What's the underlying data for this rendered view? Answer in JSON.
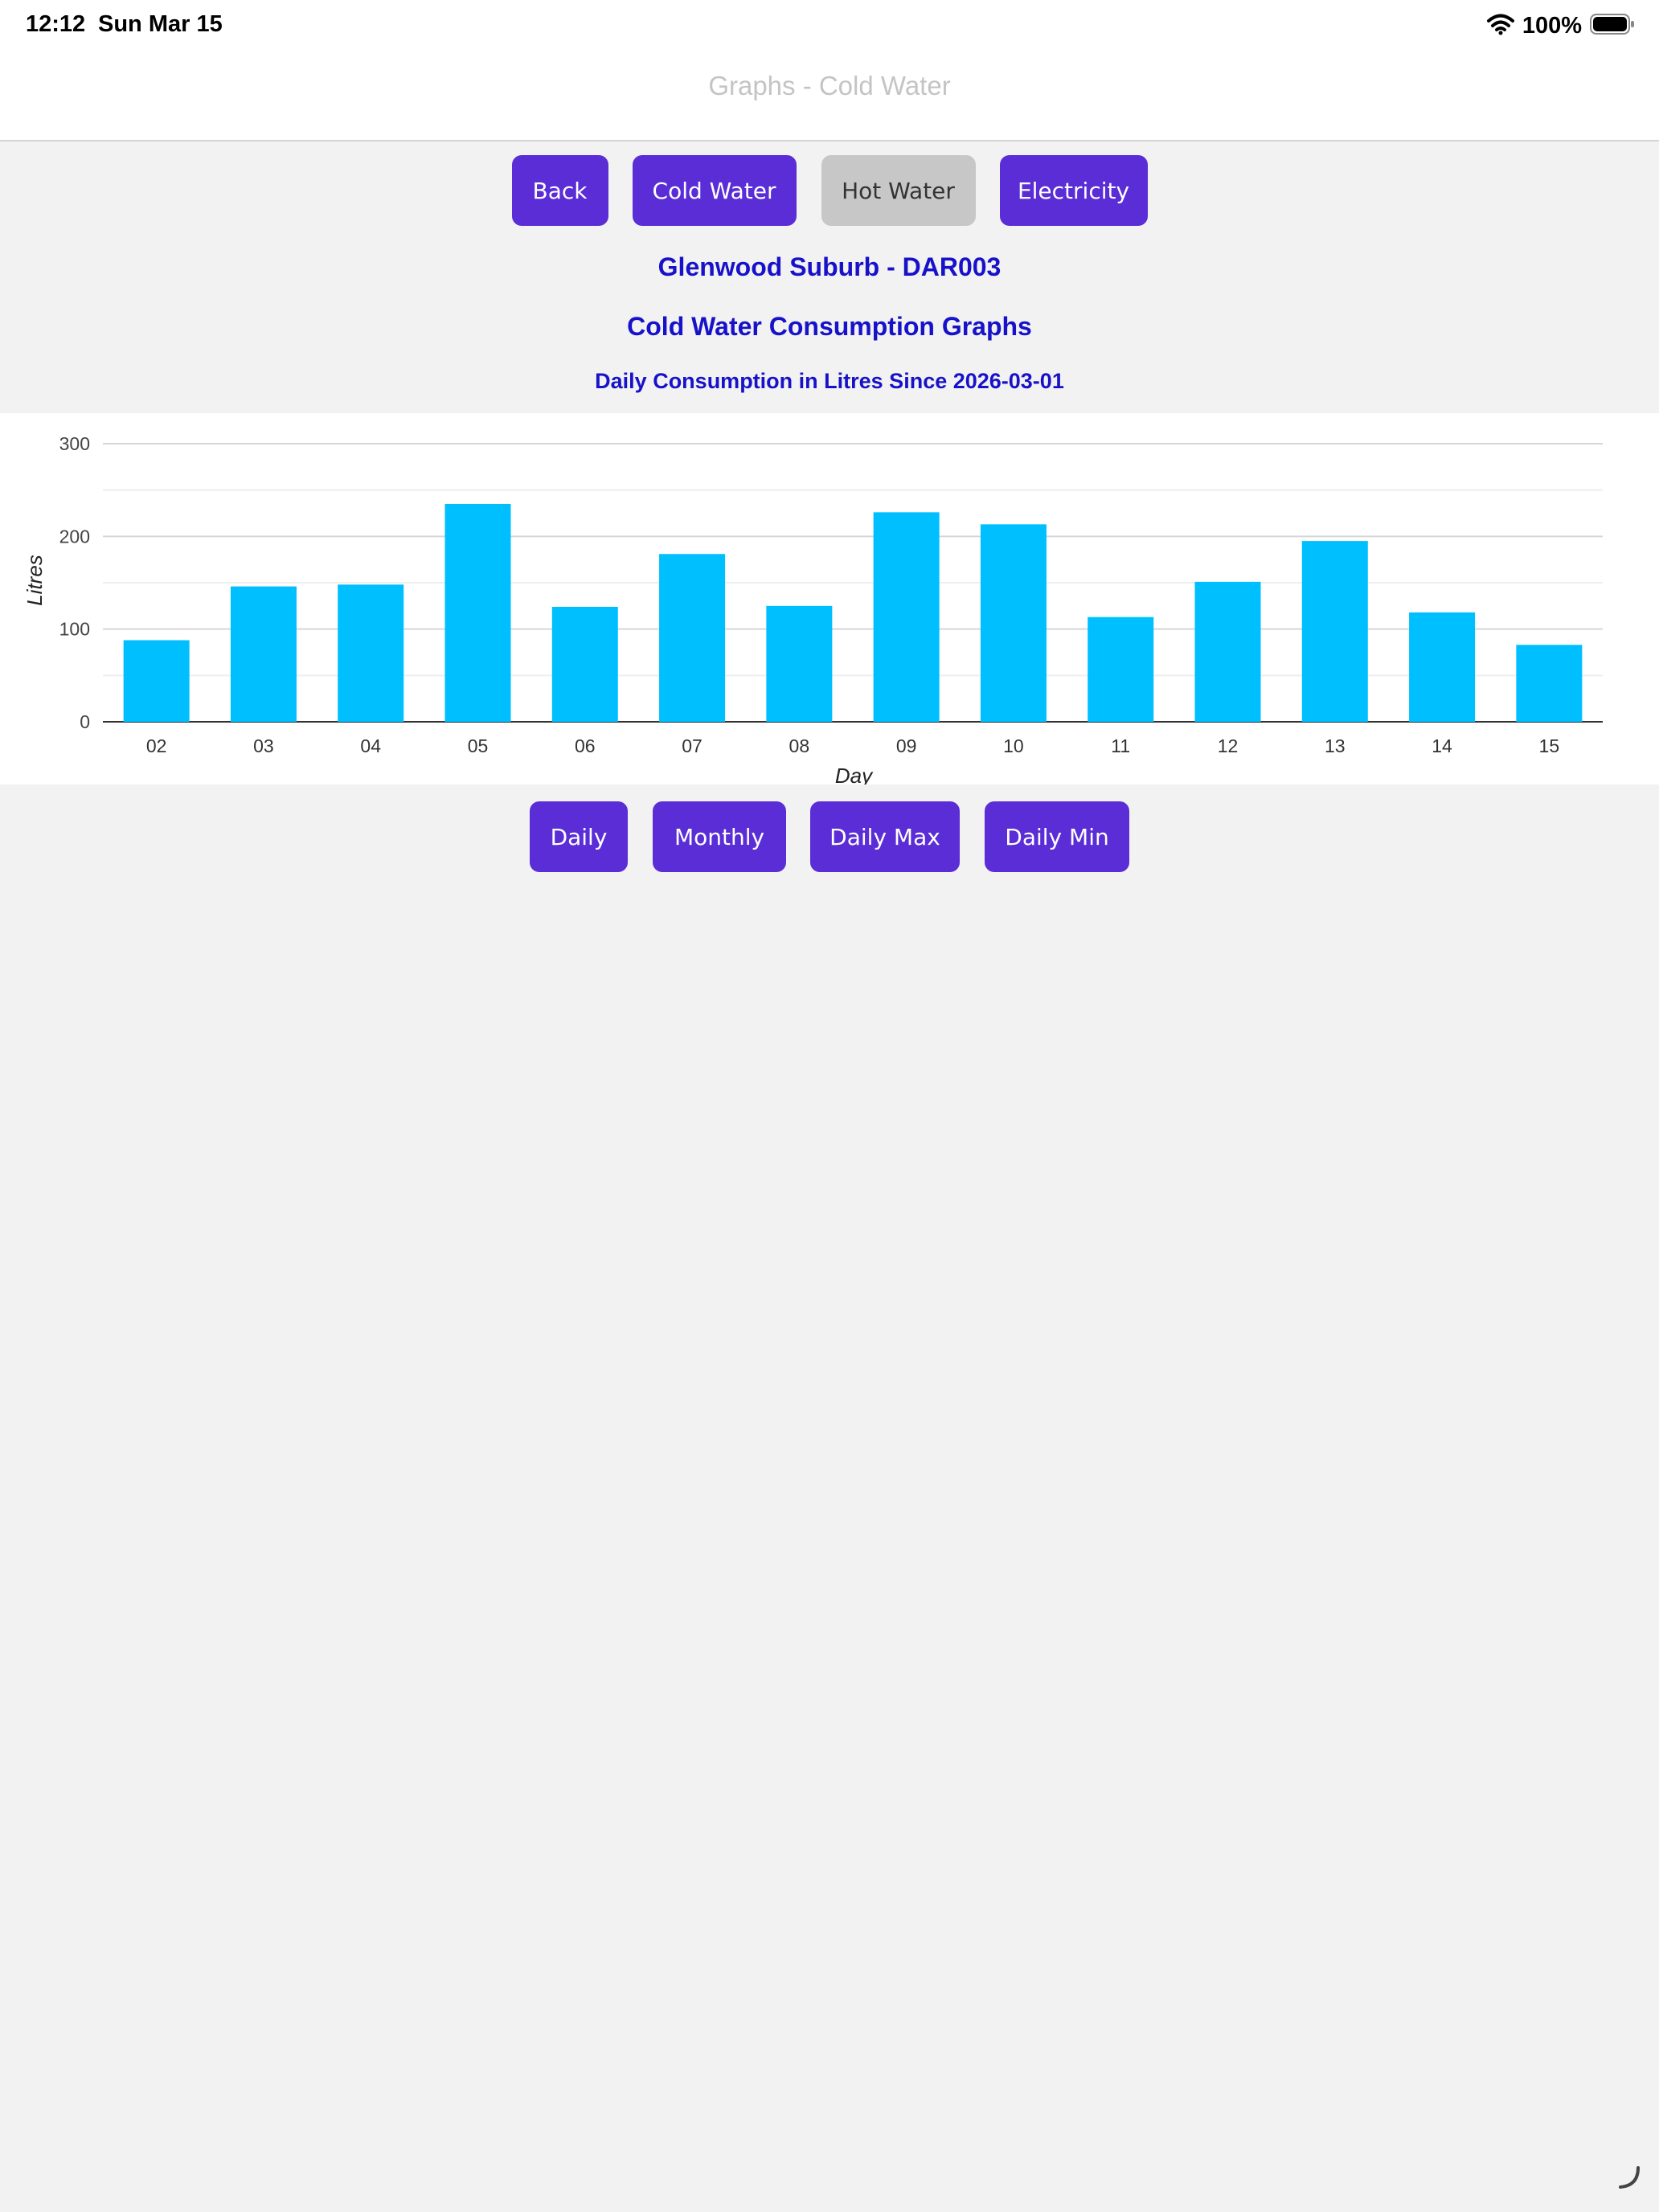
{
  "status_bar": {
    "time": "12:12",
    "date": "Sun Mar 15",
    "battery": "100%",
    "wifi_icon": "wifi-icon",
    "battery_icon": "battery-full-icon"
  },
  "nav": {
    "title": "Graphs - Cold Water"
  },
  "top_buttons": {
    "back": "Back",
    "cold_water": "Cold Water",
    "hot_water": "Hot Water",
    "electricity": "Electricity"
  },
  "headings": {
    "site": "Glenwood Suburb - DAR003",
    "title": "Cold Water Consumption Graphs",
    "subtitle": "Daily Consumption in Litres Since 2026-03-01"
  },
  "chart_data": {
    "type": "bar",
    "categories": [
      "02",
      "03",
      "04",
      "05",
      "06",
      "07",
      "08",
      "09",
      "10",
      "11",
      "12",
      "13",
      "14",
      "15"
    ],
    "values": [
      88,
      146,
      148,
      235,
      124,
      181,
      125,
      226,
      213,
      113,
      151,
      195,
      118,
      83
    ],
    "xlabel": "Day",
    "ylabel": "Litres",
    "ylim": [
      0,
      300
    ],
    "yticks": [
      0,
      100,
      200,
      300
    ],
    "grid": true,
    "bar_color": "#00bfff"
  },
  "bottom_buttons": {
    "daily": "Daily",
    "monthly": "Monthly",
    "daily_max": "Daily Max",
    "daily_min": "Daily Min"
  },
  "colors": {
    "button": "#5a2dd6",
    "button_disabled": "#c7c7c7",
    "heading": "#1712c9"
  }
}
